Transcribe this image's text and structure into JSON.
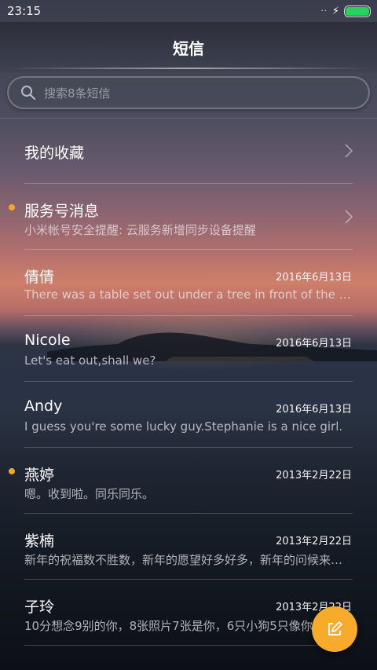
{
  "status_bar": {
    "time": "23:15",
    "signal": "··"
  },
  "header": {
    "title": "短信"
  },
  "search": {
    "placeholder": "搜索8条短信"
  },
  "favorites": {
    "label": "我的收藏"
  },
  "service": {
    "label": "服务号消息",
    "preview": "小米帐号安全提醒: 云服务新增同步设备提醒",
    "unread": true
  },
  "conversations": [
    {
      "name": "倩倩",
      "date": "2016年6月13日",
      "preview": "There was a table set out under a tree in front of the house, and the March Hare and the Hatter were having tea at it",
      "unread": false
    },
    {
      "name": "Nicole",
      "date": "2016年6月13日",
      "preview": "Let's eat out,shall we?",
      "unread": false
    },
    {
      "name": "Andy",
      "date": "2016年6月13日",
      "preview": "I guess you're some lucky guy.Stephanie is a nice girl.",
      "unread": false
    },
    {
      "name": "燕婷",
      "date": "2013年2月22日",
      "preview": "嗯。收到啦。同乐同乐。",
      "unread": true
    },
    {
      "name": "紫楠",
      "date": "2013年2月22日",
      "preview": "新年的祝福数不胜数，新年的愿望好多好多，新年的问候来自远方",
      "unread": false
    },
    {
      "name": "子玲",
      "date": "2013年2月22日",
      "preview": "10分想念9别的你，8张照片7张是你，6只小狗5只像你",
      "unread": false
    }
  ],
  "colors": {
    "accent": "#f7ab2a",
    "unread_dot": "#f5a524",
    "battery": "#27d15a"
  },
  "icons": {
    "search": "search-icon",
    "chevron": "chevron-right-icon",
    "compose": "compose-icon"
  }
}
